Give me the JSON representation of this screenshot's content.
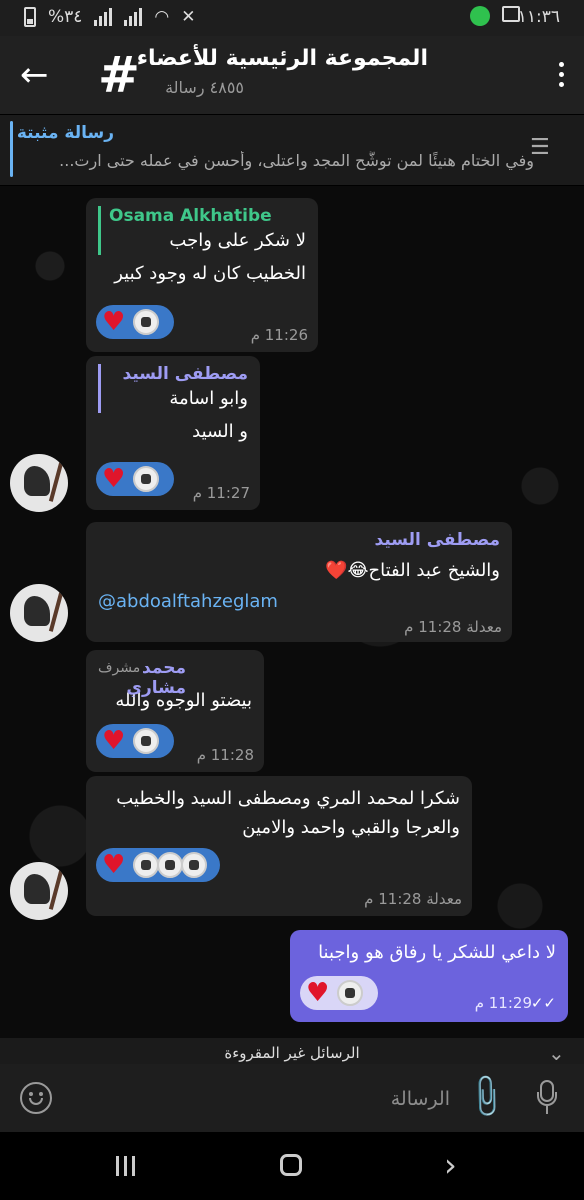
{
  "status_bar": {
    "time": "١١:٣٦",
    "battery": "%٣٤",
    "icons": [
      "whatsapp-icon",
      "gallery-icon",
      "mute-icon",
      "wifi-icon",
      "signal-icon",
      "battery-icon"
    ]
  },
  "header": {
    "title": "المجموعة الرئيسية للأعضاء",
    "subtitle": "٤٨٥٥ رسالة",
    "group_icon": "#"
  },
  "pinned": {
    "label": "رسالة مثبتة",
    "text": "وفي الختام هنيئًا لمن توشَّح المجد واعتلى، وأحسن في عمله حتى ارت..."
  },
  "messages": [
    {
      "reply_name": "Osama Alkhatibe",
      "reply_color": "#3fc78a",
      "lines": [
        "لا شكر على واجب",
        "الخطيب كان له وجود كبير"
      ],
      "time": "11:26 م",
      "reaction": "heart"
    },
    {
      "reply_name": "مصطفى السيد",
      "reply_color": "#9e9cf3",
      "lines": [
        "وابو اسامة",
        "و السيد"
      ],
      "time": "11:27 م",
      "reaction": "heart"
    },
    {
      "sender": "مصطفى السيد",
      "sender_color": "#9e9cf3",
      "line1": "والشيخ عبد الفتاح😂❤️",
      "mention": "@abdoalftahzeglam",
      "time": "معدلة 11:28 م"
    },
    {
      "sender": "محمد مشاري",
      "sender_color": "#9e9cf3",
      "role": "مشرف",
      "lines": [
        "بيضتو الوجوه والله"
      ],
      "time": "11:28 م",
      "reaction": "heart"
    },
    {
      "lines": [
        "شكرا لمحمد المري ومصطفى السيد والخطيب",
        "والعرجا والقبي واحمد والامين"
      ],
      "time": "معدلة 11:28 م",
      "reaction": "heart"
    },
    {
      "outgoing": true,
      "lines": [
        "لا داعي للشكر يا رفاق هو واجبنا"
      ],
      "time": "11:29 م",
      "reaction": "heart"
    }
  ],
  "unread_banner": "الرسائل غير المقروءة",
  "composer": {
    "placeholder": "الرسالة"
  }
}
